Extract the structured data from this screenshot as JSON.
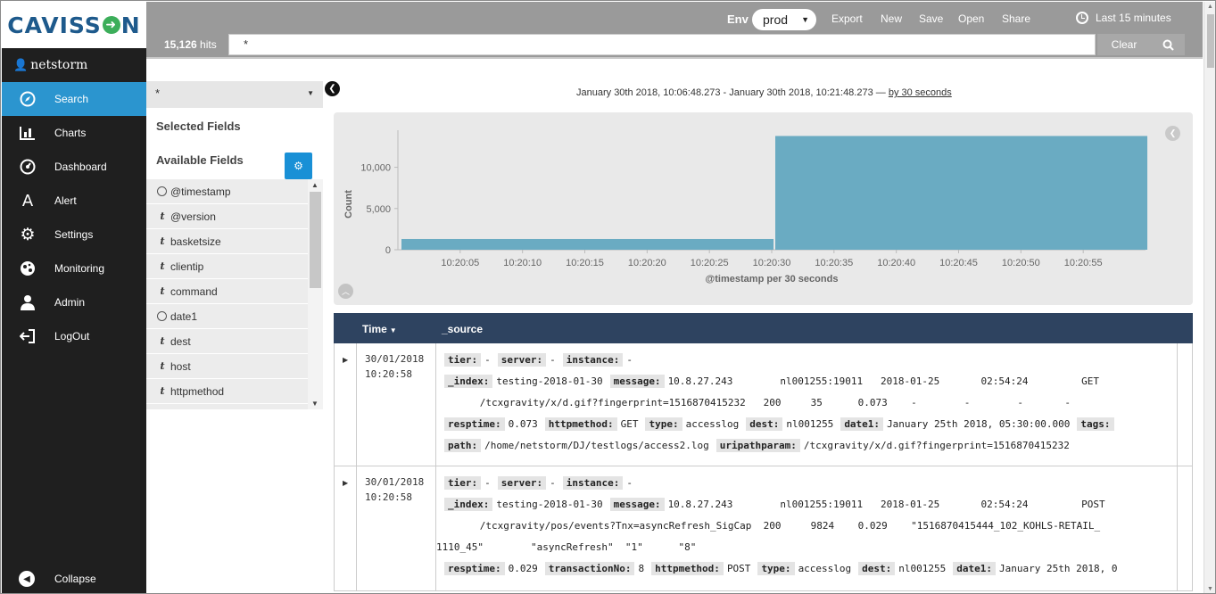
{
  "app": {
    "logo": "CAVISSON",
    "user": "netstorm"
  },
  "sidebar": {
    "items": [
      {
        "label": "Search",
        "icon": "compass-icon",
        "active": true
      },
      {
        "label": "Charts",
        "icon": "bar-chart-icon"
      },
      {
        "label": "Dashboard",
        "icon": "dashboard-icon"
      },
      {
        "label": "Alert",
        "icon": "alert-icon"
      },
      {
        "label": "Settings",
        "icon": "gear-icon"
      },
      {
        "label": "Monitoring",
        "icon": "monitoring-icon"
      },
      {
        "label": "Admin",
        "icon": "user-icon"
      },
      {
        "label": "LogOut",
        "icon": "logout-icon"
      }
    ],
    "collapse_label": "Collapse"
  },
  "topbar": {
    "env_label": "Env",
    "env_value": "prod",
    "links": [
      "Export",
      "New",
      "Save",
      "Open",
      "Share"
    ],
    "time_range": "Last 15 minutes",
    "hits_count": "15,126",
    "hits_suffix": "hits",
    "query": "*",
    "clear_label": "Clear"
  },
  "fields_panel": {
    "index_value": "*",
    "selected_title": "Selected Fields",
    "available_title": "Available Fields",
    "fields": [
      {
        "name": "@timestamp",
        "type": "clock"
      },
      {
        "name": "@version",
        "type": "t"
      },
      {
        "name": "basketsize",
        "type": "t"
      },
      {
        "name": "clientip",
        "type": "t"
      },
      {
        "name": "command",
        "type": "t"
      },
      {
        "name": "date1",
        "type": "clock"
      },
      {
        "name": "dest",
        "type": "t"
      },
      {
        "name": "host",
        "type": "t"
      },
      {
        "name": "httpmethod",
        "type": "t"
      }
    ]
  },
  "histogram": {
    "range_text": "January 30th 2018, 10:06:48.273 - January 30th 2018, 10:21:48.273 —",
    "interval_link": "by 30 seconds"
  },
  "chart_data": {
    "type": "bar",
    "ylabel": "Count",
    "xlabel": "@timestamp per 30 seconds",
    "ylim": [
      0,
      14500
    ],
    "yticks": [
      "0",
      "5,000",
      "10,000"
    ],
    "xticks": [
      "10:20:05",
      "10:20:10",
      "10:20:15",
      "10:20:20",
      "10:20:25",
      "10:20:30",
      "10:20:35",
      "10:20:40",
      "10:20:45",
      "10:20:50",
      "10:20:55"
    ],
    "bars": [
      {
        "start": "10:20:00",
        "end": "10:20:29",
        "value": 1300
      },
      {
        "start": "10:20:30",
        "end": "10:20:59",
        "value": 13800
      }
    ],
    "color": "#6aabc2"
  },
  "results": {
    "col_time": "Time",
    "col_source": "_source",
    "rows": [
      {
        "date": "30/01/2018",
        "time": "10:20:58",
        "lines": [
          [
            [
              "tier:",
              "-"
            ],
            [
              "server:",
              "-"
            ],
            [
              "instance:",
              "-"
            ]
          ],
          [
            [
              "_index:",
              "testing-2018-01-30"
            ],
            [
              "message:",
              "10.8.27.243        nl001255:19011   2018-01-25       02:54:24         GET"
            ]
          ],
          [
            [
              null,
              "      /tcxgravity/x/d.gif?fingerprint=1516870415232   200     35      0.073    -        -        -       -"
            ]
          ],
          [
            [
              "resptime:",
              "0.073"
            ],
            [
              "httpmethod:",
              "GET"
            ],
            [
              "type:",
              "accesslog"
            ],
            [
              "dest:",
              "nl001255"
            ],
            [
              "date1:",
              "January 25th 2018, 05:30:00.000"
            ],
            [
              "tags:",
              ""
            ]
          ],
          [
            [
              "path:",
              "/home/netstorm/DJ/testlogs/access2.log"
            ],
            [
              "uripathparam:",
              "/tcxgravity/x/d.gif?fingerprint=1516870415232"
            ]
          ]
        ]
      },
      {
        "date": "30/01/2018",
        "time": "10:20:58",
        "lines": [
          [
            [
              "tier:",
              "-"
            ],
            [
              "server:",
              "-"
            ],
            [
              "instance:",
              "-"
            ]
          ],
          [
            [
              "_index:",
              "testing-2018-01-30"
            ],
            [
              "message:",
              "10.8.27.243        nl001255:19011   2018-01-25       02:54:24         POST"
            ]
          ],
          [
            [
              null,
              "      /tcxgravity/pos/events?Tnx=asyncRefresh_SigCap  200     9824    0.029    \"1516870415444_102_KOHLS-RETAIL_"
            ]
          ],
          [
            [
              null,
              "1110_45\"        \"asyncRefresh\"  \"1\"      \"8\""
            ]
          ],
          [
            [
              "resptime:",
              "0.029"
            ],
            [
              "transactionNo:",
              "8"
            ],
            [
              "httpmethod:",
              "POST"
            ],
            [
              "type:",
              "accesslog"
            ],
            [
              "dest:",
              "nl001255"
            ],
            [
              "date1:",
              "January 25th 2018, 0"
            ]
          ]
        ]
      }
    ]
  }
}
